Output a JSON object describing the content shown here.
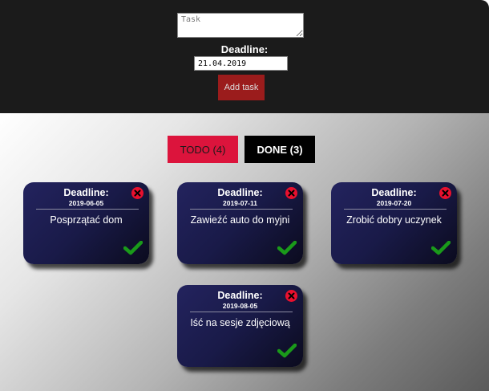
{
  "form": {
    "task_placeholder": "Task",
    "deadline_label": "Deadline:",
    "deadline_value": "21.04.2019",
    "add_button_label": "Add task"
  },
  "tabs": {
    "todo_label": "TODO (4)",
    "done_label": "DONE (3)"
  },
  "cards": [
    {
      "deadline_label": "Deadline:",
      "date": "2019-06-05",
      "title": "Posprzątać dom"
    },
    {
      "deadline_label": "Deadline:",
      "date": "2019-07-11",
      "title": "Zawieźć auto do myjni"
    },
    {
      "deadline_label": "Deadline:",
      "date": "2019-07-20",
      "title": "Zrobić dobry uczynek"
    },
    {
      "deadline_label": "Deadline:",
      "date": "2019-08-05",
      "title": "Iść na sesje zdjęciową"
    }
  ],
  "icons": {
    "close": "close-circle-icon",
    "done": "checkmark-icon"
  },
  "colors": {
    "header_bg": "#1b1b1b",
    "add_button": "#9b1c1c",
    "todo_tab": "#dc143c",
    "done_tab": "#000000",
    "card_bg": "#1f1f55",
    "close_icon": "#e8102e",
    "check_icon": "#1a9a1a"
  }
}
